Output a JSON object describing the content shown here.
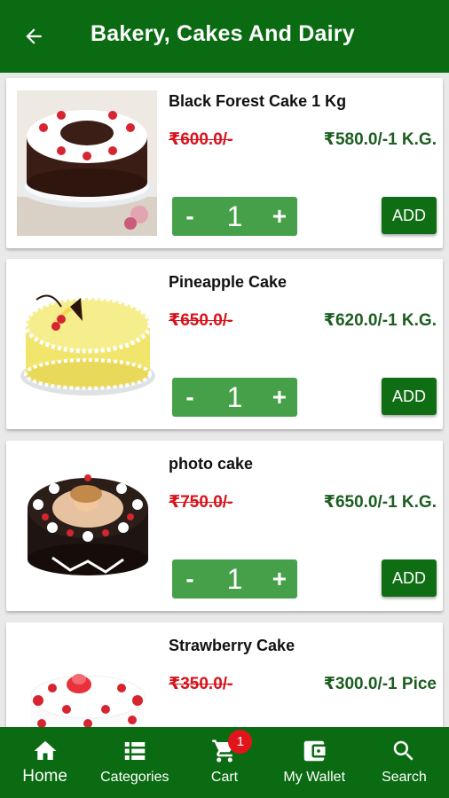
{
  "app_bar": {
    "title": "Bakery, Cakes And Dairy"
  },
  "products": [
    {
      "name": "Black Forest Cake 1 Kg",
      "old_price": "₹600.0/-",
      "new_price": "₹580.0/-1 K.G.",
      "qty": "1",
      "add_label": "ADD",
      "minus": "-",
      "plus": "+"
    },
    {
      "name": "Pineapple Cake",
      "old_price": "₹650.0/-",
      "new_price": "₹620.0/-1 K.G.",
      "qty": "1",
      "add_label": "ADD",
      "minus": "-",
      "plus": "+"
    },
    {
      "name": "photo cake",
      "old_price": "₹750.0/-",
      "new_price": "₹650.0/-1 K.G.",
      "qty": "1",
      "add_label": "ADD",
      "minus": "-",
      "plus": "+"
    },
    {
      "name": "Strawberry Cake",
      "old_price": "₹350.0/-",
      "new_price": "₹300.0/-1 Pice"
    }
  ],
  "bottom_nav": {
    "items": [
      {
        "label": "Home",
        "icon": "home-icon"
      },
      {
        "label": "Categories",
        "icon": "list-icon"
      },
      {
        "label": "Cart",
        "icon": "cart-icon",
        "badge": "1"
      },
      {
        "label": "My Wallet",
        "icon": "wallet-icon"
      },
      {
        "label": "Search",
        "icon": "search-icon"
      }
    ]
  },
  "colors": {
    "primary": "#0a6b12",
    "stepper": "#45a049",
    "old_price": "#d8121b",
    "new_price": "#1b5e20",
    "badge": "#e1141c"
  }
}
